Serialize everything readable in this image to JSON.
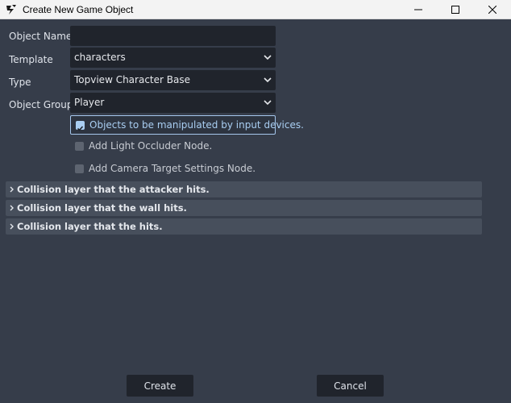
{
  "window": {
    "title": "Create New Game Object",
    "controls": [
      "minimize",
      "maximize",
      "close"
    ]
  },
  "form": {
    "object_name": {
      "label": "Object Name",
      "value": ""
    },
    "template": {
      "label": "Template",
      "value": "characters"
    },
    "type": {
      "label": "Type",
      "value": "Topview Character Base"
    },
    "object_group": {
      "label": "Object Group",
      "value": "Player"
    }
  },
  "checkboxes": [
    {
      "label": "Objects to be manipulated by input devices.",
      "checked": true
    },
    {
      "label": "Add Light Occluder Node.",
      "checked": false
    },
    {
      "label": "Add Camera Target Settings Node.",
      "checked": false
    }
  ],
  "sections": [
    {
      "label": "Collision layer that the attacker hits."
    },
    {
      "label": "Collision layer that the wall hits."
    },
    {
      "label": "Collision layer that the hits."
    }
  ],
  "buttons": {
    "create": "Create",
    "cancel": "Cancel"
  },
  "colors": {
    "background": "#363d4a",
    "field": "#20242c",
    "accent": "#a9cef2",
    "section": "#474f5c"
  }
}
